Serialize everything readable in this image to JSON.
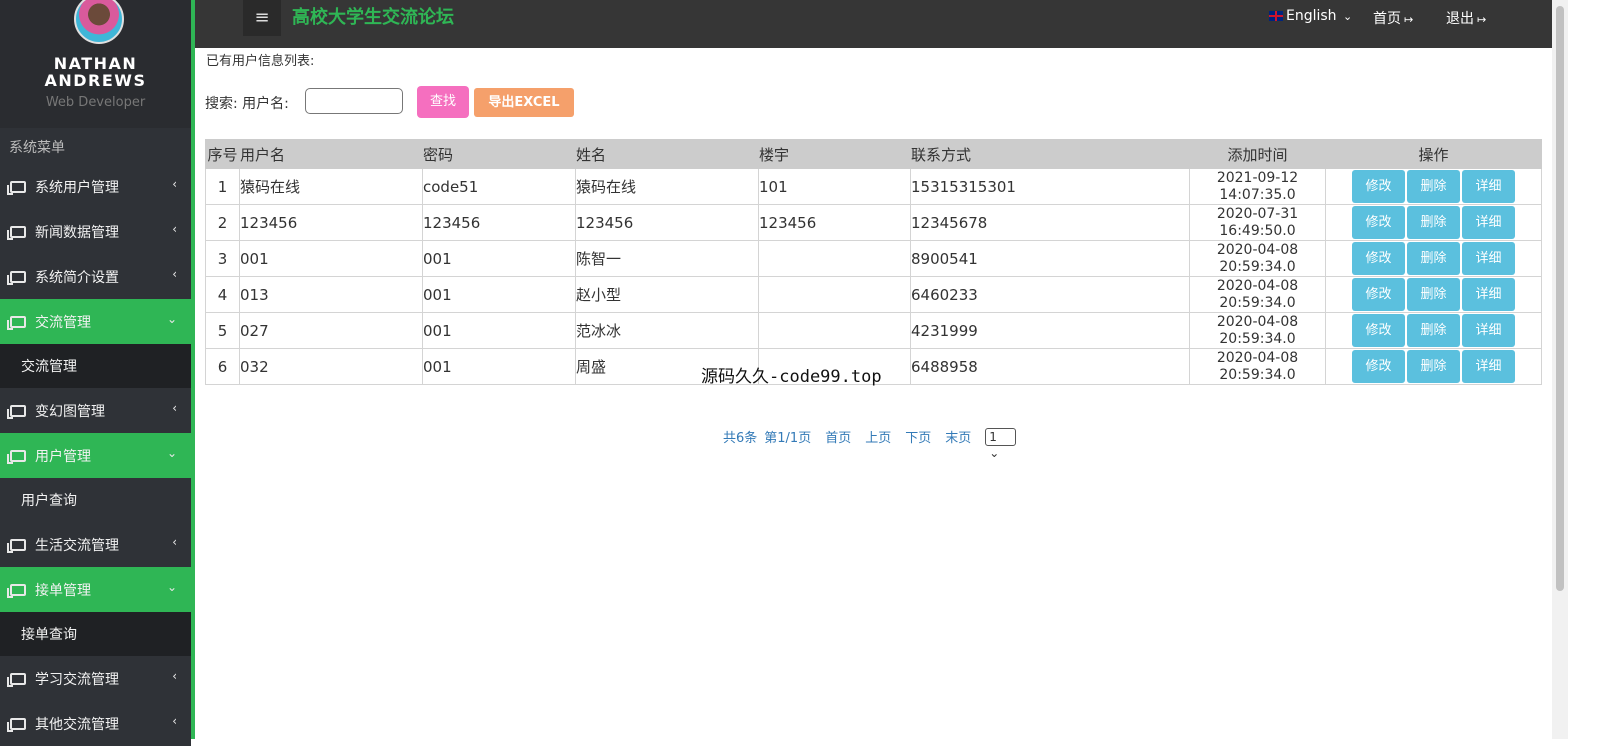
{
  "profile": {
    "name_line1": "NATHAN",
    "name_line2": "ANDREWS",
    "role": "Web Developer"
  },
  "sidebar": {
    "menu_title": "系统菜单",
    "items": [
      {
        "label": "系统用户管理",
        "expanded": false
      },
      {
        "label": "新闻数据管理",
        "expanded": false
      },
      {
        "label": "系统简介设置",
        "expanded": false
      },
      {
        "label": "交流管理",
        "expanded": true,
        "sub": "交流管理"
      },
      {
        "label": "变幻图管理",
        "expanded": false
      },
      {
        "label": "用户管理",
        "expanded": true,
        "sub": "用户查询"
      },
      {
        "label": "生活交流管理",
        "expanded": false
      },
      {
        "label": "接单管理",
        "expanded": true,
        "sub": "接单查询"
      },
      {
        "label": "学习交流管理",
        "expanded": false
      },
      {
        "label": "其他交流管理",
        "expanded": false
      }
    ]
  },
  "header": {
    "site_title": "高校大学生交流论坛",
    "language": "English",
    "home": "首页",
    "logout": "退出"
  },
  "content": {
    "list_title": "已有用户信息列表:",
    "search_label": "搜索: 用户名:",
    "search_value": "",
    "btn_search": "查找",
    "btn_export": "导出EXCEL"
  },
  "table": {
    "headers": [
      "序号",
      "用户名",
      "密码",
      "姓名",
      "楼宇",
      "联系方式",
      "添加时间",
      "操作"
    ],
    "rows": [
      {
        "no": "1",
        "username": "猿码在线",
        "password": "code51",
        "name": "猿码在线",
        "building": "101",
        "contact": "15315315301",
        "date": "2021-09-12",
        "time": "14:07:35.0"
      },
      {
        "no": "2",
        "username": "123456",
        "password": "123456",
        "name": "123456",
        "building": "123456",
        "contact": "12345678",
        "date": "2020-07-31",
        "time": "16:49:50.0"
      },
      {
        "no": "3",
        "username": "001",
        "password": "001",
        "name": "陈智一",
        "building": "",
        "contact": "8900541",
        "date": "2020-04-08",
        "time": "20:59:34.0"
      },
      {
        "no": "4",
        "username": "013",
        "password": "001",
        "name": "赵小型",
        "building": "",
        "contact": "6460233",
        "date": "2020-04-08",
        "time": "20:59:34.0"
      },
      {
        "no": "5",
        "username": "027",
        "password": "001",
        "name": "范冰冰",
        "building": "",
        "contact": "4231999",
        "date": "2020-04-08",
        "time": "20:59:34.0"
      },
      {
        "no": "6",
        "username": "032",
        "password": "001",
        "name": "周盛",
        "building": "",
        "contact": "6488958",
        "date": "2020-04-08",
        "time": "20:59:34.0"
      }
    ],
    "actions": {
      "edit": "修改",
      "delete": "删除",
      "detail": "详细"
    }
  },
  "watermark": "源码久久-code99.top",
  "pager": {
    "total": "共6条",
    "page_info": "第1/1页",
    "first": "首页",
    "prev": "上页",
    "next": "下页",
    "last": "末页",
    "selected": "1"
  },
  "colors": {
    "accent_green": "#2fb655",
    "sidebar_bg": "#2f3237",
    "header_bg": "#363636",
    "btn_info": "#5bc0de",
    "btn_pink": "#f56fbf",
    "btn_orange": "#f5a06b"
  }
}
